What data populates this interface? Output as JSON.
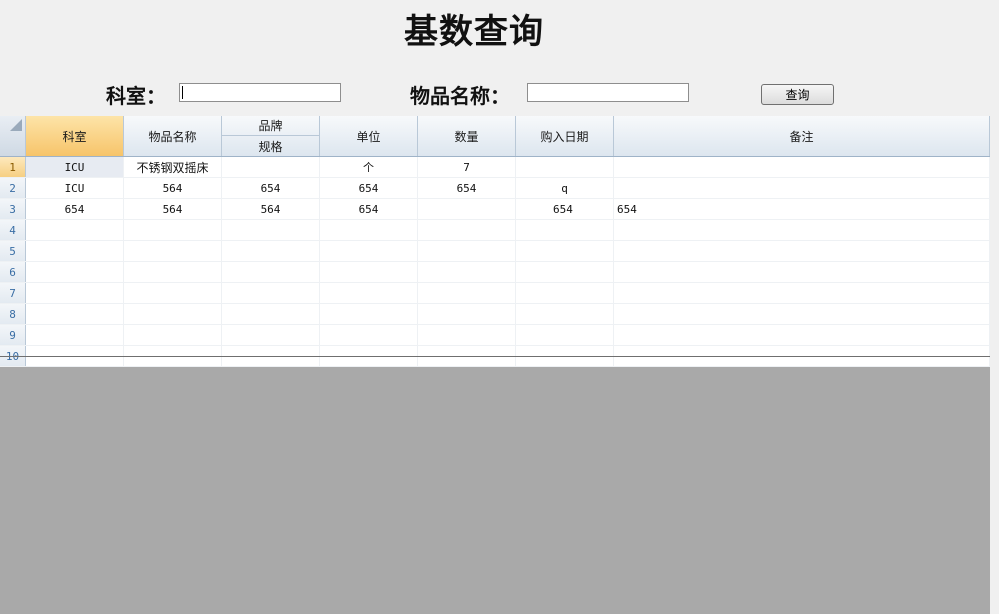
{
  "title": "基数查询",
  "search": {
    "dept_label": "科室：",
    "dept_value": "",
    "item_label": "物品名称：",
    "item_value": "",
    "query_button": "查询"
  },
  "grid": {
    "columns": {
      "dept": "科室",
      "item_name": "物品名称",
      "brand": "品牌",
      "spec": "规格",
      "unit": "单位",
      "quantity": "数量",
      "purchase_date": "购入日期",
      "remark": "备注"
    },
    "row_numbers": [
      "1",
      "2",
      "3",
      "4",
      "5",
      "6",
      "7",
      "8",
      "9",
      "10"
    ],
    "rows": [
      [
        "ICU",
        "不锈钢双摇床",
        "",
        "个",
        "7",
        "",
        ""
      ],
      [
        "ICU",
        "564",
        "654",
        "654",
        "654",
        "q",
        ""
      ],
      [
        "654",
        "564",
        "564",
        "654",
        "",
        "654",
        "654"
      ],
      [
        "",
        "",
        "",
        "",
        "",
        "",
        ""
      ],
      [
        "",
        "",
        "",
        "",
        "",
        "",
        ""
      ],
      [
        "",
        "",
        "",
        "",
        "",
        "",
        ""
      ],
      [
        "",
        "",
        "",
        "",
        "",
        "",
        ""
      ],
      [
        "",
        "",
        "",
        "",
        "",
        "",
        ""
      ],
      [
        "",
        "",
        "",
        "",
        "",
        "",
        ""
      ],
      [
        "",
        "",
        "",
        "",
        "",
        "",
        ""
      ]
    ]
  }
}
